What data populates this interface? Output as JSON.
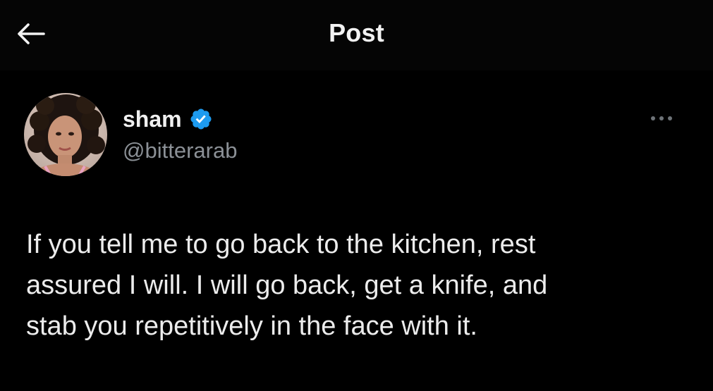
{
  "header": {
    "title": "Post",
    "back_icon": "arrow-left-icon"
  },
  "author": {
    "name": "sham",
    "handle": "@bitterarab",
    "verified": true,
    "verified_color": "#1d9bf0",
    "avatar_icon": "avatar-photo"
  },
  "post": {
    "lines": [
      "If you tell me to go back to the kitchen, rest",
      "assured I will. I will go back, get a knife, and",
      "stab you repetitively in the face with it."
    ]
  },
  "actions": {
    "more_icon": "more-options-icon"
  },
  "colors": {
    "background": "#000000",
    "text": "#e7e9ea",
    "secondary_text": "#8b9096"
  }
}
